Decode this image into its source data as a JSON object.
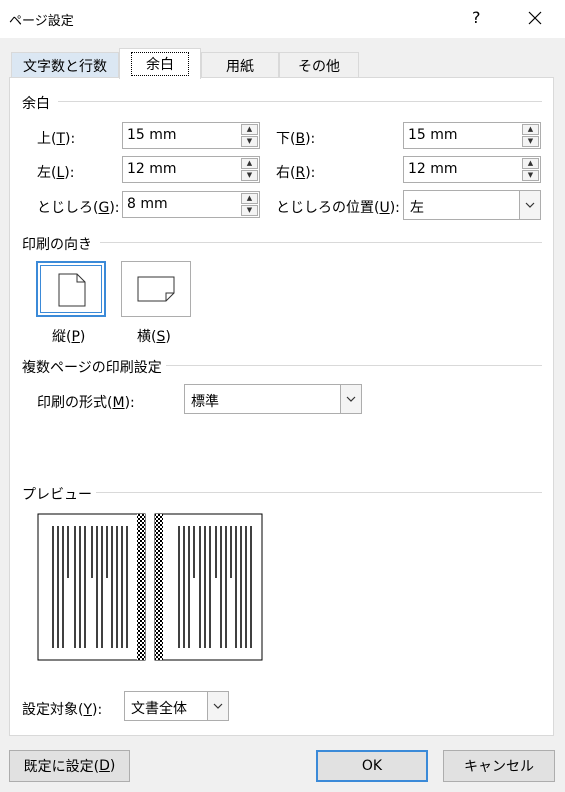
{
  "window": {
    "title": "ページ設定",
    "help": "?"
  },
  "tabs": [
    {
      "label": "文字数と行数"
    },
    {
      "label": "余白"
    },
    {
      "label": "用紙"
    },
    {
      "label": "その他"
    }
  ],
  "margins": {
    "section_title": "余白",
    "top": {
      "label": "上(",
      "key": "T",
      "tail": "):",
      "value": "15 mm"
    },
    "bottom": {
      "label": "下(",
      "key": "B",
      "tail": "):",
      "value": "15 mm"
    },
    "left": {
      "label": "左(",
      "key": "L",
      "tail": "):",
      "value": "12 mm"
    },
    "right": {
      "label": "右(",
      "key": "R",
      "tail": "):",
      "value": "12 mm"
    },
    "gutter": {
      "label": "とじしろ(",
      "key": "G",
      "tail": "):",
      "value": "8 mm"
    },
    "gutter_pos": {
      "label": "とじしろの位置(",
      "key": "U",
      "tail": "):",
      "value": "左"
    }
  },
  "orientation": {
    "section_title": "印刷の向き",
    "portrait": {
      "label": "縦(",
      "key": "P",
      "tail": ")"
    },
    "landscape": {
      "label": "横(",
      "key": "S",
      "tail": ")"
    }
  },
  "multipage": {
    "section_title": "複数ページの印刷設定",
    "format": {
      "label": "印刷の形式(",
      "key": "M",
      "tail": "):",
      "value": "標準"
    }
  },
  "preview": {
    "section_title": "プレビュー"
  },
  "apply_to": {
    "label": "設定対象(",
    "key": "Y",
    "tail": "):",
    "value": "文書全体"
  },
  "buttons": {
    "default": {
      "label": "既定に設定(",
      "key": "D",
      "tail": ")"
    },
    "ok": "OK",
    "cancel": "キャンセル"
  }
}
